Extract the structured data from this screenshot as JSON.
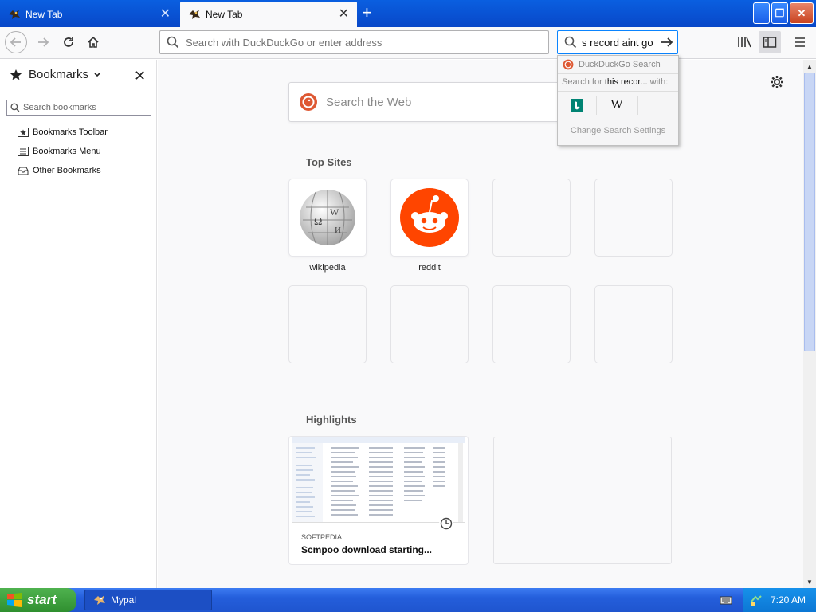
{
  "browser": {
    "tabs": [
      {
        "title": "New Tab",
        "active": false
      },
      {
        "title": "New Tab",
        "active": true
      }
    ],
    "url_placeholder": "Search with DuckDuckGo or enter address",
    "search_value": "s record aint go"
  },
  "search_dropdown": {
    "engine": "DuckDuckGo Search",
    "search_for_prefix": "Search for",
    "search_for_query": "this recor...",
    "with_label": "with:",
    "engines": [
      "bing",
      "wikipedia"
    ],
    "settings_label": "Change Search Settings"
  },
  "sidebar": {
    "title": "Bookmarks",
    "search_placeholder": "Search bookmarks",
    "items": [
      {
        "label": "Bookmarks Toolbar",
        "icon": "bookmarks-toolbar-icon"
      },
      {
        "label": "Bookmarks Menu",
        "icon": "bookmarks-menu-icon"
      },
      {
        "label": "Other Bookmarks",
        "icon": "other-bookmarks-icon"
      }
    ]
  },
  "newtab": {
    "search_placeholder": "Search the Web",
    "top_sites_title": "Top Sites",
    "top_sites": [
      {
        "label": "wikipedia"
      },
      {
        "label": "reddit"
      }
    ],
    "highlights_title": "Highlights",
    "highlight": {
      "source": "SOFTPEDIA",
      "title": "Scmpoo download starting..."
    }
  },
  "taskbar": {
    "start_label": "start",
    "task_label": "Mypal",
    "clock": "7:20 AM"
  },
  "colors": {
    "titlebar": "#0847c8",
    "accent": "#0a84ff",
    "duckduckgo": "#de5833",
    "reddit": "#ff4500",
    "taskbar": "#245edb",
    "start": "#2f8f2f"
  }
}
